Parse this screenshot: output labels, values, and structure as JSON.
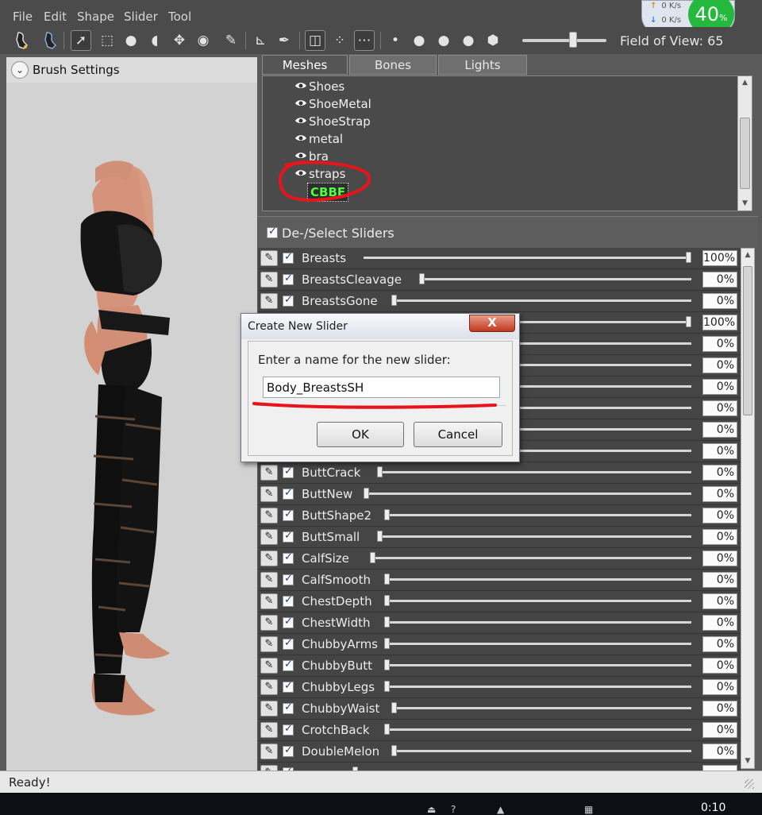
{
  "menu": [
    "File",
    "Edit",
    "Shape",
    "Slider",
    "Tool"
  ],
  "tray": {
    "upload_rate": "0 K/s",
    "download_rate": "0 K/s",
    "cpu_value": "40",
    "cpu_unit": "%"
  },
  "toolbar": {
    "fov_label": "Field of View: 65",
    "fov_value": 65
  },
  "left_panel": {
    "title": "Brush Settings"
  },
  "tabs": [
    "Meshes",
    "Bones",
    "Lights"
  ],
  "meshes": [
    "Shoes",
    "ShoeMetal",
    "ShoeStrap",
    "metal",
    "bra",
    "straps",
    "CBBE"
  ],
  "slider_panel": {
    "deselect_label": "De-/Select Sliders"
  },
  "sliders": [
    {
      "name": "Breasts",
      "value": "100%",
      "level": 1.0
    },
    {
      "name": "BreastsCleavage",
      "value": "0%",
      "level": 0.0
    },
    {
      "name": "BreastsGone",
      "value": "0%",
      "level": 0.0
    },
    {
      "name": "",
      "value": "100%",
      "level": 1.0
    },
    {
      "name": "",
      "value": "0%",
      "level": 0.0
    },
    {
      "name": "",
      "value": "0%",
      "level": 0.0
    },
    {
      "name": "",
      "value": "0%",
      "level": 0.0
    },
    {
      "name": "",
      "value": "0%",
      "level": 0.0
    },
    {
      "name": "",
      "value": "0%",
      "level": 0.0
    },
    {
      "name": "",
      "value": "0%",
      "level": 0.0
    },
    {
      "name": "ButtCrack",
      "value": "0%",
      "level": 0.0
    },
    {
      "name": "ButtNew",
      "value": "0%",
      "level": 0.0
    },
    {
      "name": "ButtShape2",
      "value": "0%",
      "level": 0.0
    },
    {
      "name": "ButtSmall",
      "value": "0%",
      "level": 0.0
    },
    {
      "name": "CalfSize",
      "value": "0%",
      "level": 0.0
    },
    {
      "name": "CalfSmooth",
      "value": "0%",
      "level": 0.0
    },
    {
      "name": "ChestDepth",
      "value": "0%",
      "level": 0.0
    },
    {
      "name": "ChestWidth",
      "value": "0%",
      "level": 0.0
    },
    {
      "name": "ChubbyArms",
      "value": "0%",
      "level": 0.0
    },
    {
      "name": "ChubbyButt",
      "value": "0%",
      "level": 0.0
    },
    {
      "name": "ChubbyLegs",
      "value": "0%",
      "level": 0.0
    },
    {
      "name": "ChubbyWaist",
      "value": "0%",
      "level": 0.0
    },
    {
      "name": "CrotchBack",
      "value": "0%",
      "level": 0.0
    },
    {
      "name": "DoubleMelon",
      "value": "0%",
      "level": 0.0
    },
    {
      "name": "",
      "value": "",
      "level": 0.0
    }
  ],
  "status": {
    "text": "Ready!"
  },
  "taskbar": {
    "clock": "0:10"
  },
  "dialog": {
    "title": "Create New Slider",
    "close_label": "X",
    "prompt": "Enter a name for the new slider:",
    "input_value": "Body_BreastsSH",
    "ok_label": "OK",
    "cancel_label": "Cancel"
  },
  "colors": {
    "annotation": "#e8141c",
    "cbbe_highlight": "#4cff3b",
    "cpu_badge": "#24b83d"
  }
}
